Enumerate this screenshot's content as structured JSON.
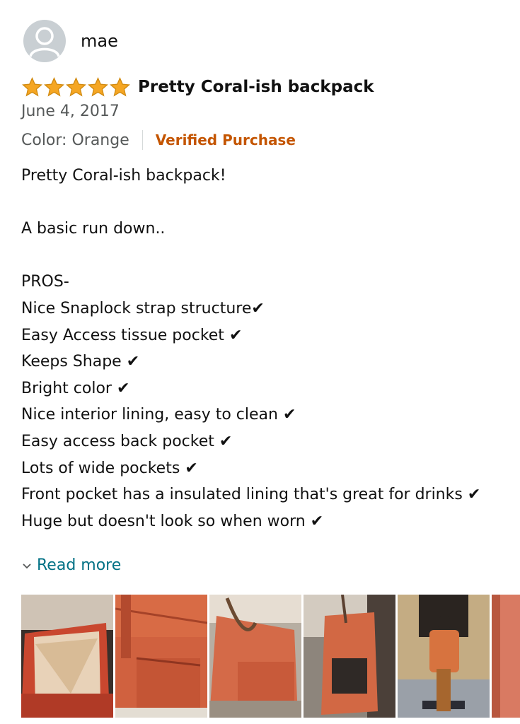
{
  "reviewer": {
    "name": "mae",
    "avatar_icon": "user-silhouette-icon"
  },
  "review": {
    "rating": 5,
    "rating_max": 5,
    "title": "Pretty Coral-ish backpack",
    "date": "June 4, 2017",
    "color_label": "Color: Orange",
    "verified_label": "Verified Purchase",
    "body_lines": [
      "Pretty Coral-ish backpack!",
      "",
      "A basic run down..",
      "",
      "PROS-",
      "Nice Snaplock strap structure",
      "Easy Access tissue pocket ",
      "Keeps Shape ",
      "Bright color ",
      "Nice interior lining, easy to clean ",
      "Easy access back pocket ",
      "Lots of wide pockets ",
      "Front pocket has a insulated lining that's great for drinks ",
      "Huge but doesn't look so when worn "
    ],
    "check_glyph": "✔",
    "read_more_label": "Read more"
  },
  "colors": {
    "star": "#f5a623",
    "verified": "#c45500",
    "link": "#007185",
    "secondary_text": "#565959"
  },
  "images": [
    {
      "name": "review-photo-1",
      "subject": "open backpack interior"
    },
    {
      "name": "review-photo-2",
      "subject": "backpack side pocket"
    },
    {
      "name": "review-photo-3",
      "subject": "backpack handle"
    },
    {
      "name": "review-photo-4",
      "subject": "backpack side view"
    },
    {
      "name": "review-photo-5",
      "subject": "person wearing backpack"
    },
    {
      "name": "review-photo-6",
      "subject": "backpack fabric close-up"
    }
  ]
}
